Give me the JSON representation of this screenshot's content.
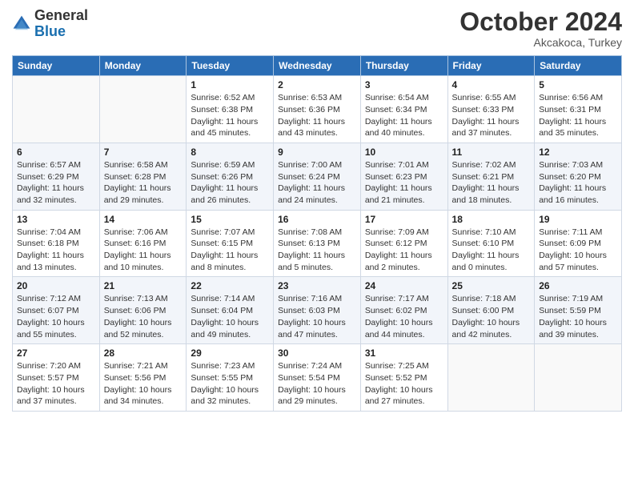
{
  "header": {
    "logo_general": "General",
    "logo_blue": "Blue",
    "month_year": "October 2024",
    "location": "Akcakoca, Turkey"
  },
  "days_of_week": [
    "Sunday",
    "Monday",
    "Tuesday",
    "Wednesday",
    "Thursday",
    "Friday",
    "Saturday"
  ],
  "weeks": [
    [
      {
        "day": "",
        "detail": ""
      },
      {
        "day": "",
        "detail": ""
      },
      {
        "day": "1",
        "detail": "Sunrise: 6:52 AM\nSunset: 6:38 PM\nDaylight: 11 hours and 45 minutes."
      },
      {
        "day": "2",
        "detail": "Sunrise: 6:53 AM\nSunset: 6:36 PM\nDaylight: 11 hours and 43 minutes."
      },
      {
        "day": "3",
        "detail": "Sunrise: 6:54 AM\nSunset: 6:34 PM\nDaylight: 11 hours and 40 minutes."
      },
      {
        "day": "4",
        "detail": "Sunrise: 6:55 AM\nSunset: 6:33 PM\nDaylight: 11 hours and 37 minutes."
      },
      {
        "day": "5",
        "detail": "Sunrise: 6:56 AM\nSunset: 6:31 PM\nDaylight: 11 hours and 35 minutes."
      }
    ],
    [
      {
        "day": "6",
        "detail": "Sunrise: 6:57 AM\nSunset: 6:29 PM\nDaylight: 11 hours and 32 minutes."
      },
      {
        "day": "7",
        "detail": "Sunrise: 6:58 AM\nSunset: 6:28 PM\nDaylight: 11 hours and 29 minutes."
      },
      {
        "day": "8",
        "detail": "Sunrise: 6:59 AM\nSunset: 6:26 PM\nDaylight: 11 hours and 26 minutes."
      },
      {
        "day": "9",
        "detail": "Sunrise: 7:00 AM\nSunset: 6:24 PM\nDaylight: 11 hours and 24 minutes."
      },
      {
        "day": "10",
        "detail": "Sunrise: 7:01 AM\nSunset: 6:23 PM\nDaylight: 11 hours and 21 minutes."
      },
      {
        "day": "11",
        "detail": "Sunrise: 7:02 AM\nSunset: 6:21 PM\nDaylight: 11 hours and 18 minutes."
      },
      {
        "day": "12",
        "detail": "Sunrise: 7:03 AM\nSunset: 6:20 PM\nDaylight: 11 hours and 16 minutes."
      }
    ],
    [
      {
        "day": "13",
        "detail": "Sunrise: 7:04 AM\nSunset: 6:18 PM\nDaylight: 11 hours and 13 minutes."
      },
      {
        "day": "14",
        "detail": "Sunrise: 7:06 AM\nSunset: 6:16 PM\nDaylight: 11 hours and 10 minutes."
      },
      {
        "day": "15",
        "detail": "Sunrise: 7:07 AM\nSunset: 6:15 PM\nDaylight: 11 hours and 8 minutes."
      },
      {
        "day": "16",
        "detail": "Sunrise: 7:08 AM\nSunset: 6:13 PM\nDaylight: 11 hours and 5 minutes."
      },
      {
        "day": "17",
        "detail": "Sunrise: 7:09 AM\nSunset: 6:12 PM\nDaylight: 11 hours and 2 minutes."
      },
      {
        "day": "18",
        "detail": "Sunrise: 7:10 AM\nSunset: 6:10 PM\nDaylight: 11 hours and 0 minutes."
      },
      {
        "day": "19",
        "detail": "Sunrise: 7:11 AM\nSunset: 6:09 PM\nDaylight: 10 hours and 57 minutes."
      }
    ],
    [
      {
        "day": "20",
        "detail": "Sunrise: 7:12 AM\nSunset: 6:07 PM\nDaylight: 10 hours and 55 minutes."
      },
      {
        "day": "21",
        "detail": "Sunrise: 7:13 AM\nSunset: 6:06 PM\nDaylight: 10 hours and 52 minutes."
      },
      {
        "day": "22",
        "detail": "Sunrise: 7:14 AM\nSunset: 6:04 PM\nDaylight: 10 hours and 49 minutes."
      },
      {
        "day": "23",
        "detail": "Sunrise: 7:16 AM\nSunset: 6:03 PM\nDaylight: 10 hours and 47 minutes."
      },
      {
        "day": "24",
        "detail": "Sunrise: 7:17 AM\nSunset: 6:02 PM\nDaylight: 10 hours and 44 minutes."
      },
      {
        "day": "25",
        "detail": "Sunrise: 7:18 AM\nSunset: 6:00 PM\nDaylight: 10 hours and 42 minutes."
      },
      {
        "day": "26",
        "detail": "Sunrise: 7:19 AM\nSunset: 5:59 PM\nDaylight: 10 hours and 39 minutes."
      }
    ],
    [
      {
        "day": "27",
        "detail": "Sunrise: 7:20 AM\nSunset: 5:57 PM\nDaylight: 10 hours and 37 minutes."
      },
      {
        "day": "28",
        "detail": "Sunrise: 7:21 AM\nSunset: 5:56 PM\nDaylight: 10 hours and 34 minutes."
      },
      {
        "day": "29",
        "detail": "Sunrise: 7:23 AM\nSunset: 5:55 PM\nDaylight: 10 hours and 32 minutes."
      },
      {
        "day": "30",
        "detail": "Sunrise: 7:24 AM\nSunset: 5:54 PM\nDaylight: 10 hours and 29 minutes."
      },
      {
        "day": "31",
        "detail": "Sunrise: 7:25 AM\nSunset: 5:52 PM\nDaylight: 10 hours and 27 minutes."
      },
      {
        "day": "",
        "detail": ""
      },
      {
        "day": "",
        "detail": ""
      }
    ]
  ]
}
